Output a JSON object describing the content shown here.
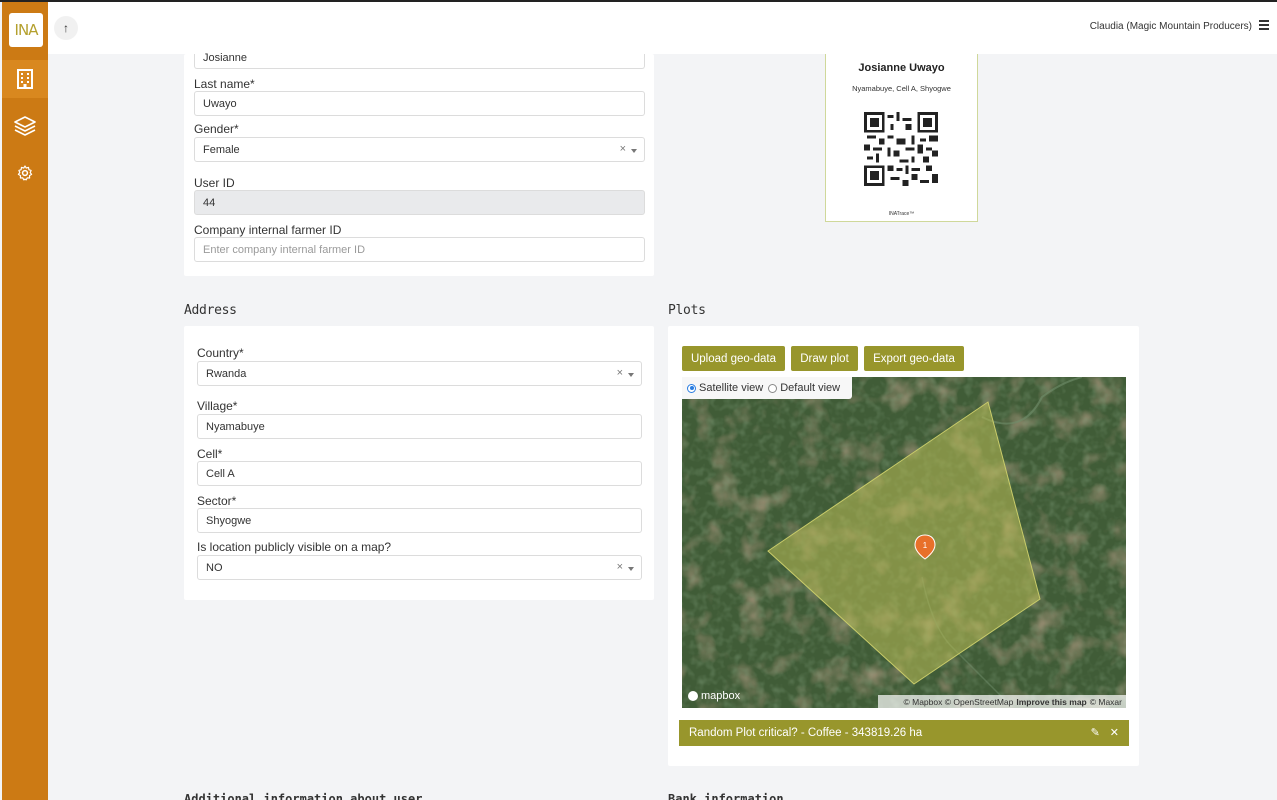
{
  "app": {
    "logo_text": "INA"
  },
  "header": {
    "up_arrow": "↑",
    "user": "Claudia (Magic Mountain Producers)"
  },
  "sidebar": {
    "items": [
      {
        "icon": "building-icon",
        "active": true
      },
      {
        "icon": "layers-icon",
        "active": false
      },
      {
        "icon": "gear-icon",
        "active": false
      }
    ]
  },
  "farmer": {
    "first_name_value": "Josianne",
    "last_name_label": "Last name*",
    "last_name_value": "Uwayo",
    "gender_label": "Gender*",
    "gender_value": "Female",
    "user_id_label": "User ID",
    "user_id_value": "44",
    "company_id_label": "Company internal farmer ID",
    "company_id_placeholder": "Enter company internal farmer ID"
  },
  "id_card": {
    "name": "Josianne Uwayo",
    "location": "Nyamabuye, Cell A, Shyogwe",
    "brand": "INATrace™"
  },
  "address": {
    "title": "Address",
    "country_label": "Country*",
    "country_value": "Rwanda",
    "village_label": "Village*",
    "village_value": "Nyamabuye",
    "cell_label": "Cell*",
    "cell_value": "Cell A",
    "sector_label": "Sector*",
    "sector_value": "Shyogwe",
    "visible_label": "Is location publicly visible on a map?",
    "visible_value": "NO"
  },
  "plots": {
    "title": "Plots",
    "upload_button": "Upload geo-data",
    "draw_button": "Draw plot",
    "export_button": "Export geo-data",
    "satellite_label": "Satellite view",
    "default_label": "Default view",
    "marker_label": "1",
    "mapbox_logo": "mapbox",
    "attribution_1": "© Mapbox © OpenStreetMap",
    "attribution_2": "Improve this map",
    "attribution_3": "© Maxar",
    "plot_row_text": "Random Plot critical? - Coffee - 343819.26 ha",
    "edit_icon": "✎",
    "delete_icon": "✕"
  },
  "bottom": {
    "left_title": "Additional information about user",
    "right_title": "Bank information"
  },
  "colors": {
    "sidebar": "#cc7a14",
    "olive": "#98962c",
    "marker": "#e8702a"
  }
}
